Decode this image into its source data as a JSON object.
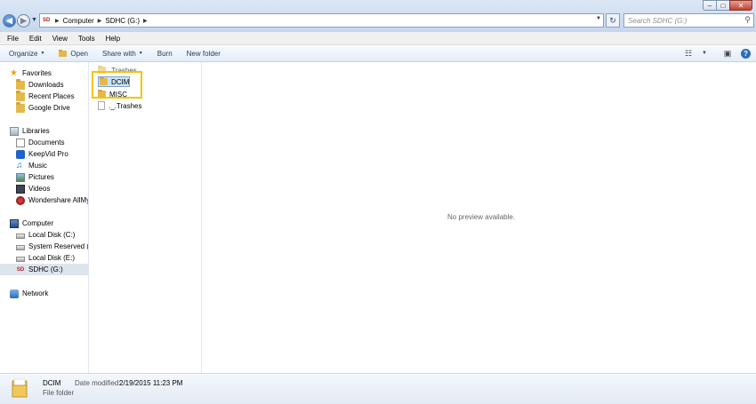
{
  "address": {
    "breadcrumb": [
      "Computer",
      "SDHC (G:)"
    ],
    "drive_badge": "SD",
    "search_placeholder": "Search SDHC (G:)"
  },
  "menu": [
    "File",
    "Edit",
    "View",
    "Tools",
    "Help"
  ],
  "commands": {
    "organize": "Organize",
    "open": "Open",
    "share_with": "Share with",
    "burn": "Burn",
    "new_folder": "New folder"
  },
  "nav": {
    "favorites": "Favorites",
    "downloads": "Downloads",
    "recent_places": "Recent Places",
    "google_drive": "Google Drive",
    "libraries": "Libraries",
    "documents": "Documents",
    "keepvid": "KeepVid Pro",
    "music": "Music",
    "pictures": "Pictures",
    "videos": "Videos",
    "wondershare": "Wondershare AllMyT",
    "computer": "Computer",
    "local_c": "Local Disk (C:)",
    "system_reserved": "System Reserved (D:",
    "local_e": "Local Disk (E:)",
    "sdhc": "SDHC (G:)",
    "network": "Network"
  },
  "files": {
    "trashes_hidden": ".Trashes",
    "dcim": "DCIM",
    "misc": "MISC",
    "trashes_file": "._.Trashes"
  },
  "preview": {
    "message": "No preview available."
  },
  "details": {
    "name": "DCIM",
    "type": "File folder",
    "modified_label": "Date modified:",
    "modified_value": "2/19/2015 11:23 PM"
  },
  "colors": {
    "highlight": "#f5c300",
    "selection": "#cce4f7",
    "folder": "#e3b94a"
  }
}
